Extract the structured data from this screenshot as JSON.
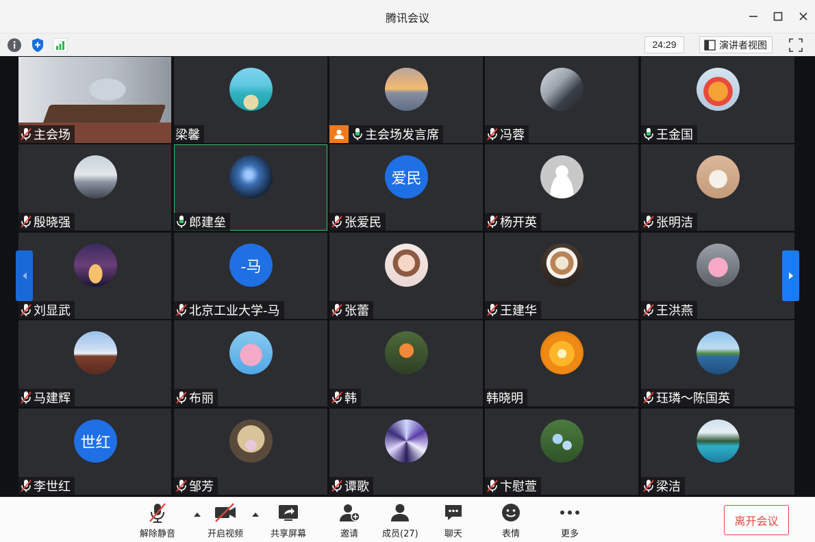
{
  "window": {
    "title": "腾讯会议"
  },
  "infobar": {
    "timer": "24:29",
    "speaker_view_label": "演讲者视图"
  },
  "participants": [
    {
      "name": "主会场",
      "mic": "muted",
      "avatar": {
        "kind": "room"
      }
    },
    {
      "name": "梁馨",
      "mic": "none",
      "avatar": {
        "kind": "photo",
        "icon": "beach-photo"
      }
    },
    {
      "name": "主会场发言席",
      "mic": "on",
      "host": true,
      "avatar": {
        "kind": "photo",
        "icon": "sunset-sea-photo"
      }
    },
    {
      "name": "冯蓉",
      "mic": "muted",
      "avatar": {
        "kind": "photo",
        "icon": "person-chair-photo"
      }
    },
    {
      "name": "王金国",
      "mic": "on",
      "avatar": {
        "kind": "photo",
        "icon": "toy-photo"
      }
    },
    {
      "name": "殷晓强",
      "mic": "muted",
      "avatar": {
        "kind": "photo",
        "icon": "couple-beach-photo"
      }
    },
    {
      "name": "郎建垒",
      "mic": "on",
      "active": true,
      "avatar": {
        "kind": "photo",
        "icon": "galaxy-photo"
      }
    },
    {
      "name": "张爱民",
      "mic": "muted",
      "avatar": {
        "kind": "text",
        "text": "爱民"
      }
    },
    {
      "name": "杨开英",
      "mic": "muted",
      "avatar": {
        "kind": "default",
        "icon": "default-person"
      }
    },
    {
      "name": "张明洁",
      "mic": "muted",
      "avatar": {
        "kind": "photo",
        "icon": "mouse-toy-photo"
      }
    },
    {
      "name": "刘显武",
      "mic": "muted",
      "avatar": {
        "kind": "photo",
        "icon": "night-building-photo"
      }
    },
    {
      "name": "北京工业大学-马",
      "mic": "muted",
      "avatar": {
        "kind": "text",
        "text": "-马"
      }
    },
    {
      "name": "张蕾",
      "mic": "muted",
      "avatar": {
        "kind": "photo",
        "icon": "cartoon-girl-photo"
      }
    },
    {
      "name": "王建华",
      "mic": "muted",
      "avatar": {
        "kind": "photo",
        "icon": "latte-photo"
      }
    },
    {
      "name": "王洪燕",
      "mic": "muted",
      "avatar": {
        "kind": "photo",
        "icon": "pink-cat-photo"
      }
    },
    {
      "name": "马建辉",
      "mic": "muted",
      "avatar": {
        "kind": "photo",
        "icon": "palace-photo"
      }
    },
    {
      "name": "布丽",
      "mic": "muted",
      "avatar": {
        "kind": "photo",
        "icon": "pink-bird-photo"
      }
    },
    {
      "name": "韩",
      "mic": "muted",
      "avatar": {
        "kind": "photo",
        "icon": "flower-photo"
      }
    },
    {
      "name": "韩晓明",
      "mic": "none",
      "avatar": {
        "kind": "photo",
        "icon": "sun-photo"
      }
    },
    {
      "name": "珏璘～陈国英",
      "mic": "muted",
      "avatar": {
        "kind": "photo",
        "icon": "lake-photo"
      }
    },
    {
      "name": "李世红",
      "mic": "muted",
      "avatar": {
        "kind": "text",
        "text": "世红"
      }
    },
    {
      "name": "邹芳",
      "mic": "muted",
      "avatar": {
        "kind": "photo",
        "icon": "duck-photo"
      }
    },
    {
      "name": "谭歌",
      "mic": "muted",
      "avatar": {
        "kind": "photo",
        "icon": "kaleidoscope-photo"
      }
    },
    {
      "name": "卞慰萱",
      "mic": "muted",
      "avatar": {
        "kind": "photo",
        "icon": "blue-flower-photo"
      }
    },
    {
      "name": "梁洁",
      "mic": "muted",
      "avatar": {
        "kind": "photo",
        "icon": "mountain-lake-photo"
      }
    }
  ],
  "toolbar": {
    "unmute": "解除静音",
    "video": "开启视频",
    "share": "共享屏幕",
    "invite": "邀请",
    "members": "成员(27)",
    "chat": "聊天",
    "emoji": "表情",
    "more": "更多",
    "leave": "离开会议"
  },
  "colors": {
    "accent": "#1a7cf5",
    "leave": "#e0463e",
    "active_border": "#3bc36a",
    "host_badge": "#f07b1d"
  }
}
